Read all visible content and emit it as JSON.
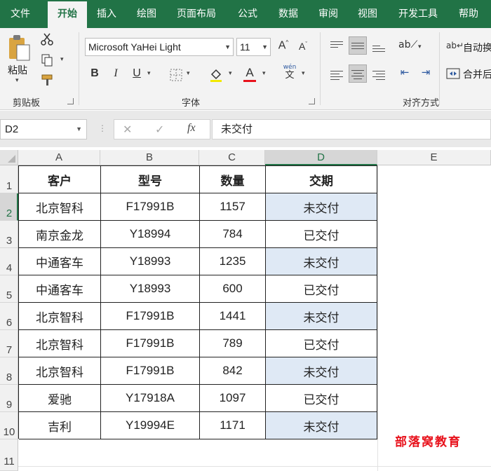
{
  "tabs": [
    "文件",
    "开始",
    "插入",
    "绘图",
    "页面布局",
    "公式",
    "数据",
    "审阅",
    "视图",
    "开发工具",
    "帮助"
  ],
  "active_tab": "开始",
  "ribbon": {
    "clipboard": {
      "paste_label": "粘贴",
      "group_label": "剪贴板"
    },
    "font": {
      "font_name": "Microsoft YaHei Light",
      "font_size": "11",
      "group_label": "字体",
      "bold": "B",
      "italic": "I",
      "underline": "U",
      "font_color_glyph": "A",
      "phonetic_glyph": "wén",
      "phonetic_base": "文"
    },
    "alignment": {
      "wrap_label": "自动换",
      "merge_label": "合并后",
      "group_label": "对齐方式"
    },
    "colors": {
      "accent": "#217346",
      "font_color": "#e8121c"
    }
  },
  "formula_bar": {
    "name_box": "D2",
    "cancel_glyph": "✕",
    "enter_glyph": "✓",
    "fx_glyph": "fx",
    "formula": "未交付"
  },
  "sheet": {
    "columns": [
      "A",
      "B",
      "C",
      "D",
      "E"
    ],
    "rows": [
      "1",
      "2",
      "3",
      "4",
      "5",
      "6",
      "7",
      "8",
      "9",
      "10",
      "11"
    ],
    "headers": [
      "客户",
      "型号",
      "数量",
      "交期"
    ],
    "data": [
      [
        "北京智科",
        "F17991B",
        "1157",
        "未交付"
      ],
      [
        "南京金龙",
        "Y18994",
        "784",
        "已交付"
      ],
      [
        "中通客车",
        "Y18993",
        "1235",
        "未交付"
      ],
      [
        "中通客车",
        "Y18993",
        "600",
        "已交付"
      ],
      [
        "北京智科",
        "F17991B",
        "1441",
        "未交付"
      ],
      [
        "北京智科",
        "F17991B",
        "789",
        "已交付"
      ],
      [
        "北京智科",
        "F17991B",
        "842",
        "未交付"
      ],
      [
        "爱驰",
        "Y17918A",
        "1097",
        "已交付"
      ],
      [
        "吉利",
        "Y19994E",
        "1171",
        "未交付"
      ]
    ],
    "highlight_color": "#dfe9f5"
  },
  "watermark": "部落窝教育"
}
